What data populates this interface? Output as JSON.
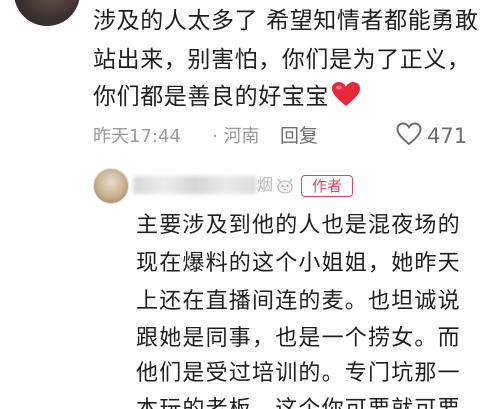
{
  "comment": {
    "lines": [
      "涉及的人太多了 希望知情者都能勇敢",
      "站出来，别害怕，你们是为了正义，",
      "你们都是善良的好宝宝"
    ],
    "heart_icon": "red-heart-emoji",
    "time": "昨天17:44",
    "location": "· 河南",
    "reply_label": "回复",
    "like_icon": "heart-outline-icon",
    "like_count": "471"
  },
  "reply": {
    "name_suffix": "烟",
    "cat_icon": "cat-face-icon",
    "author_badge": "作者",
    "badge_color": "#e0466a",
    "lines": [
      "主要涉及到他的人也是混夜场的",
      "现在爆料的这个小姐姐，她昨天",
      "上还在直播间连的麦。也坦诚说",
      "跟她是同事，也是一个捞女。而",
      "他们是受过培训的。专门坑那一",
      "本玩的老板，这个你可要就可要"
    ]
  }
}
